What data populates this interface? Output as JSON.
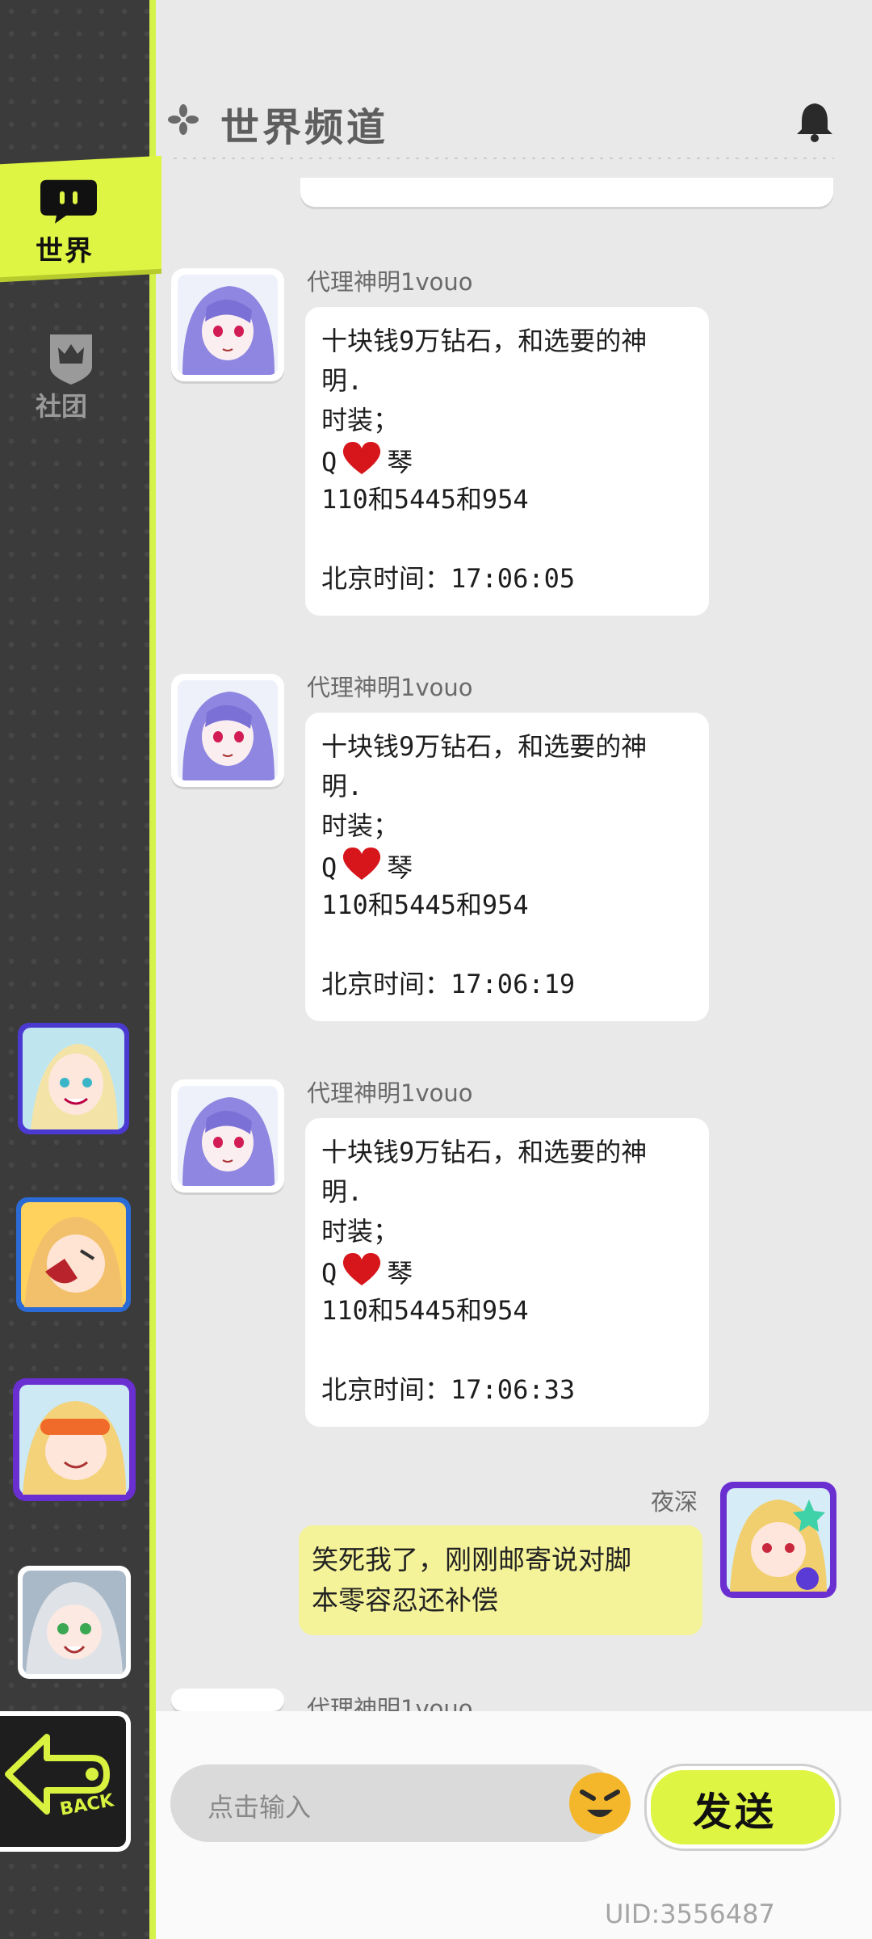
{
  "header": {
    "title": "世界频道"
  },
  "sidebar": {
    "tabs": [
      {
        "label": "世界",
        "active": true
      },
      {
        "label": "社团",
        "active": false
      }
    ],
    "back_label": "BACK"
  },
  "messages": [
    {
      "name": "代理神明1vouo",
      "lines": [
        "十块钱9万钻石，和选要的神",
        "明.",
        "时装；",
        "Q|琴",
        "110和5445和954",
        "",
        "北京时间：17:06:05"
      ],
      "q": "Q",
      "qin": "琴"
    },
    {
      "name": "代理神明1vouo",
      "lines": [
        "十块钱9万钻石，和选要的神",
        "明.",
        "时装；",
        "Q|琴",
        "110和5445和954",
        "",
        "北京时间：17:06:19"
      ]
    },
    {
      "name": "代理神明1vouo",
      "lines": [
        "十块钱9万钻石，和选要的神",
        "明.",
        "时装；",
        "Q|琴",
        "110和5445和954",
        "",
        "北京时间：17:06:33"
      ]
    }
  ],
  "self_message": {
    "name": "夜深",
    "line1": "笑死我了，刚刚邮寄说对脚",
    "line2": "本零容忍还补偿"
  },
  "partial_message": {
    "name": "代理神明1vouo"
  },
  "composer": {
    "placeholder": "点击输入",
    "send_label": "发送"
  },
  "uid": "UID:3556487",
  "colors": {
    "accent": "#dff544",
    "self_bubble": "#f5f39a",
    "sidebar": "#3b3b3b"
  }
}
